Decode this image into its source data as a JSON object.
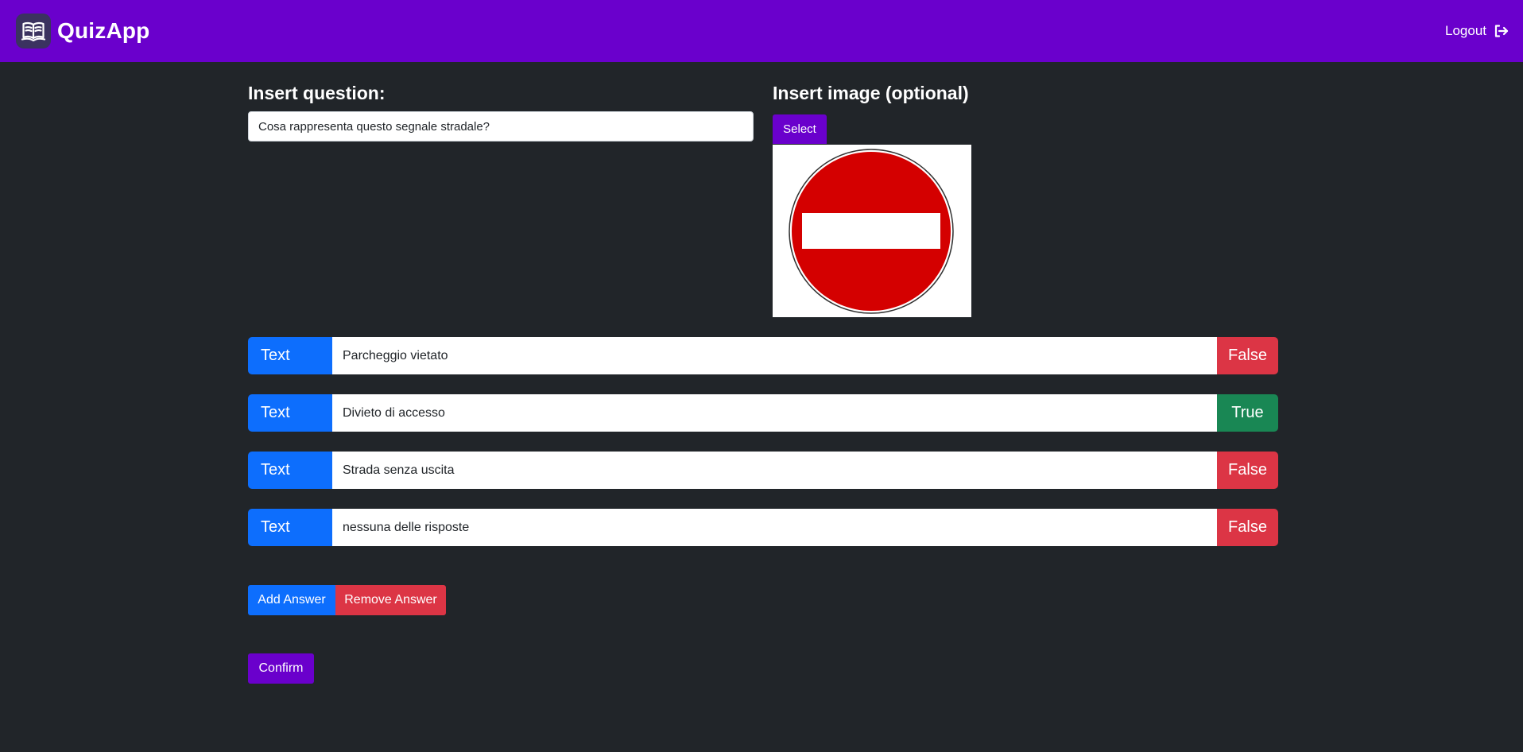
{
  "navbar": {
    "brand_name": "QuizApp",
    "logout_label": "Logout",
    "color": "#6a00cc"
  },
  "question": {
    "heading": "Insert question:",
    "value": "Cosa rappresenta questo segnale stradale?"
  },
  "image": {
    "heading": "Insert image (optional)",
    "select_label": "Select",
    "preview": "no-entry-road-sign"
  },
  "answers": [
    {
      "type_label": "Text",
      "value": "Parcheggio vietato",
      "flag": "False"
    },
    {
      "type_label": "Text",
      "value": "Divieto di accesso",
      "flag": "True"
    },
    {
      "type_label": "Text",
      "value": "Strada senza uscita",
      "flag": "False"
    },
    {
      "type_label": "Text",
      "value": "nessuna delle risposte",
      "flag": "False"
    }
  ],
  "actions": {
    "add_label": "Add Answer",
    "remove_label": "Remove Answer",
    "confirm_label": "Confirm"
  },
  "colors": {
    "background": "#212529",
    "primary": "#0d6efd",
    "danger": "#dc3545",
    "success": "#198754",
    "accent": "#6a00cc"
  }
}
